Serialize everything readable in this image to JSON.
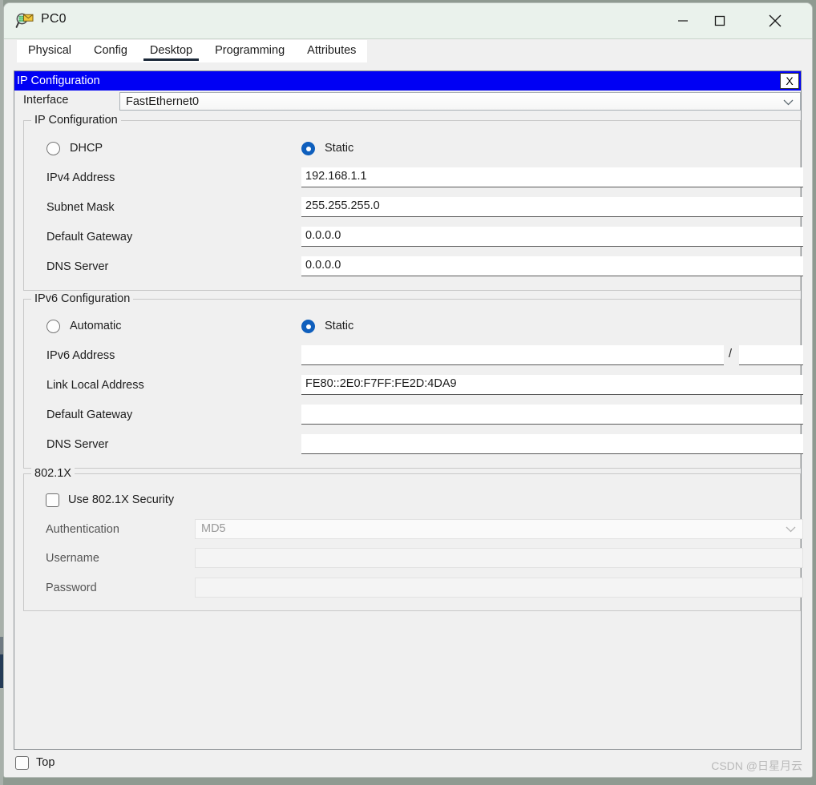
{
  "window": {
    "title": "PC0",
    "icon": "packet-tracer-inspect-icon",
    "controls": {
      "minimize": "—",
      "maximize": "□",
      "close": "✕"
    }
  },
  "tabs": [
    {
      "label": "Physical",
      "active": false
    },
    {
      "label": "Config",
      "active": false
    },
    {
      "label": "Desktop",
      "active": true
    },
    {
      "label": "Programming",
      "active": false
    },
    {
      "label": "Attributes",
      "active": false
    }
  ],
  "ip_configuration_frame": {
    "title": "IP Configuration",
    "close_label": "X",
    "title_bar_color": "#0000f4"
  },
  "interface": {
    "label": "Interface",
    "value": "FastEthernet0"
  },
  "ipv4": {
    "group_title": "IP Configuration",
    "mode": {
      "dhcp_label": "DHCP",
      "dhcp_selected": false,
      "static_label": "Static",
      "static_selected": true
    },
    "fields": [
      {
        "label": "IPv4 Address",
        "value": "192.168.1.1"
      },
      {
        "label": "Subnet Mask",
        "value": "255.255.255.0"
      },
      {
        "label": "Default Gateway",
        "value": "0.0.0.0"
      },
      {
        "label": "DNS Server",
        "value": "0.0.0.0"
      }
    ]
  },
  "ipv6": {
    "group_title": "IPv6 Configuration",
    "mode": {
      "automatic_label": "Automatic",
      "automatic_selected": false,
      "static_label": "Static",
      "static_selected": true
    },
    "address_label": "IPv6 Address",
    "address_value": "",
    "prefix_separator": "/",
    "prefix_value": "",
    "fields": [
      {
        "label": "Link Local Address",
        "value": "FE80::2E0:F7FF:FE2D:4DA9"
      },
      {
        "label": "Default Gateway",
        "value": ""
      },
      {
        "label": "DNS Server",
        "value": ""
      }
    ]
  },
  "dot1x": {
    "group_title": "802.1X",
    "use_security_label": "Use 802.1X Security",
    "use_security_checked": false,
    "authentication_label": "Authentication",
    "authentication_value": "MD5",
    "username_label": "Username",
    "username_value": "",
    "password_label": "Password",
    "password_value": ""
  },
  "bottom": {
    "top_label": "Top",
    "top_checked": false,
    "watermark": "CSDN @日星月云"
  },
  "colors": {
    "accent_blue": "#0f5fbd",
    "frame_blue": "#0000f4",
    "titlebar": "#eaf2ec",
    "panel": "#f0f0f0"
  }
}
